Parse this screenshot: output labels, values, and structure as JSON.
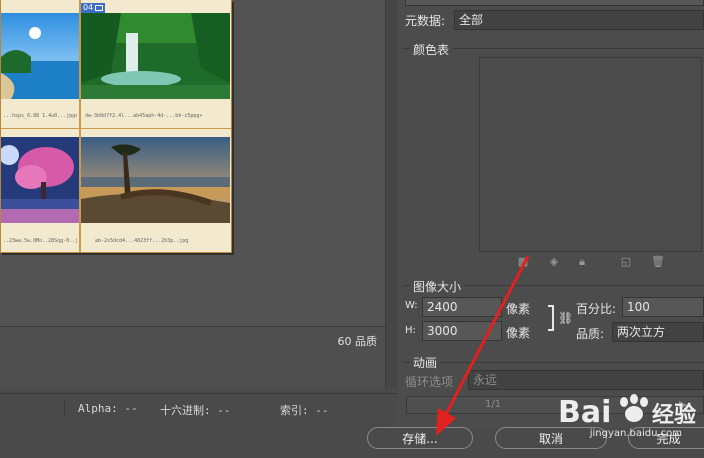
{
  "preview": {
    "tiles": [
      {
        "caption": "...hsps_6.88 1.4u0...jpg+"
      },
      {
        "caption": "dw-3b0d7f2.4l...ab45aph-4d-...bh-c5ppg+"
      },
      {
        "caption": "..23ww.5w.0Mo..28Sqg-0..jpg"
      },
      {
        "caption": "ab-2s5dcd4...4823ff...2b3p..jpg"
      }
    ],
    "badge_number": "04",
    "quality": "60 品质"
  },
  "status_bar": {
    "alpha": "Alpha: --",
    "hex": "十六进制: --",
    "index": "索引: --"
  },
  "right_panel": {
    "metadata_label": "元数据:",
    "metadata_value": "全部",
    "color_table_title": "颜色表",
    "image_size_title": "图像大小",
    "w_label": "W:",
    "w_value": "2400",
    "w_unit": "像素",
    "h_label": "H:",
    "h_value": "3000",
    "h_unit": "像素",
    "percent_label": "百分比:",
    "percent_value": "100",
    "quality_label": "品质:",
    "quality_value": "两次立方",
    "animation_title": "动画",
    "loop_label": "循环选项",
    "loop_value": "永远",
    "frame_counter": "1/1"
  },
  "buttons": {
    "save": "存储...",
    "cancel": "取消",
    "done": "完成"
  },
  "watermark": {
    "brand": "Bai经验",
    "url": "jingyan.baidu.com"
  },
  "colors": {
    "arrow": "#e32020",
    "badge": "#3d6fc4",
    "doc_border": "#b6873a"
  }
}
